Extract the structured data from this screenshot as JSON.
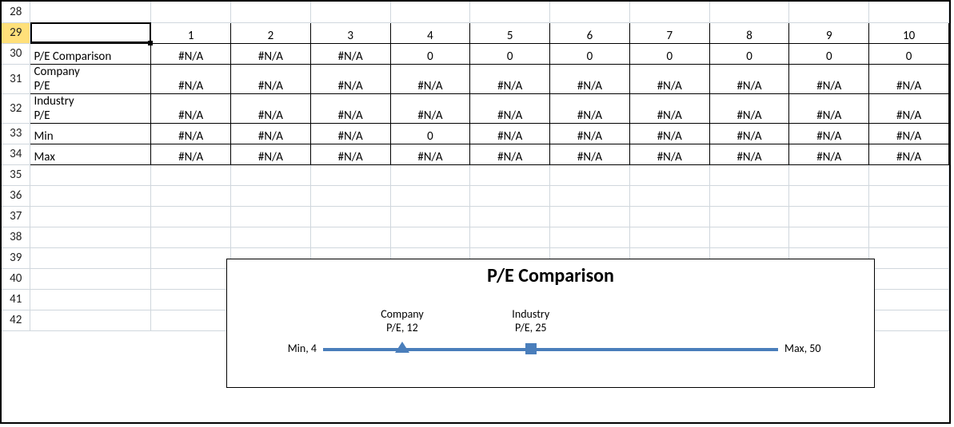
{
  "rows_visible": [
    "28",
    "29",
    "30",
    "31",
    "32",
    "33",
    "34",
    "35",
    "36",
    "37",
    "38",
    "39",
    "40",
    "41",
    "42"
  ],
  "selected_row_label": "29",
  "table": {
    "header_cols": [
      "1",
      "2",
      "3",
      "4",
      "5",
      "6",
      "7",
      "8",
      "9",
      "10"
    ],
    "rows": [
      {
        "label": "P/E Comparison",
        "values": [
          "#N/A",
          "#N/A",
          "#N/A",
          "0",
          "0",
          "0",
          "0",
          "0",
          "0",
          "0"
        ],
        "tall": false
      },
      {
        "label": "Company\nP/E",
        "values": [
          "#N/A",
          "#N/A",
          "#N/A",
          "#N/A",
          "#N/A",
          "#N/A",
          "#N/A",
          "#N/A",
          "#N/A",
          "#N/A"
        ],
        "tall": true
      },
      {
        "label": "Industry\nP/E",
        "values": [
          "#N/A",
          "#N/A",
          "#N/A",
          "#N/A",
          "#N/A",
          "#N/A",
          "#N/A",
          "#N/A",
          "#N/A",
          "#N/A"
        ],
        "tall": true
      },
      {
        "label": "Min",
        "values": [
          "#N/A",
          "#N/A",
          "#N/A",
          "0",
          "#N/A",
          "#N/A",
          "#N/A",
          "#N/A",
          "#N/A",
          "#N/A"
        ],
        "tall": false
      },
      {
        "label": "Max",
        "values": [
          "#N/A",
          "#N/A",
          "#N/A",
          "#N/A",
          "#N/A",
          "#N/A",
          "#N/A",
          "#N/A",
          "#N/A",
          "#N/A"
        ],
        "tall": false
      }
    ]
  },
  "chart_data": {
    "type": "scatter",
    "title": "P/E Comparison",
    "x_axis_range": [
      4,
      50
    ],
    "series": [
      {
        "name": "Min",
        "x": 4,
        "label": "Min, 4",
        "display": "endpoint-left"
      },
      {
        "name": "Company P/E",
        "x": 12,
        "label": "Company\nP/E, 12",
        "display": "marker-triangle"
      },
      {
        "name": "Industry P/E",
        "x": 25,
        "label": "Industry\nP/E, 25",
        "display": "marker-square"
      },
      {
        "name": "Max",
        "x": 50,
        "label": "Max, 50",
        "display": "endpoint-right"
      }
    ]
  }
}
